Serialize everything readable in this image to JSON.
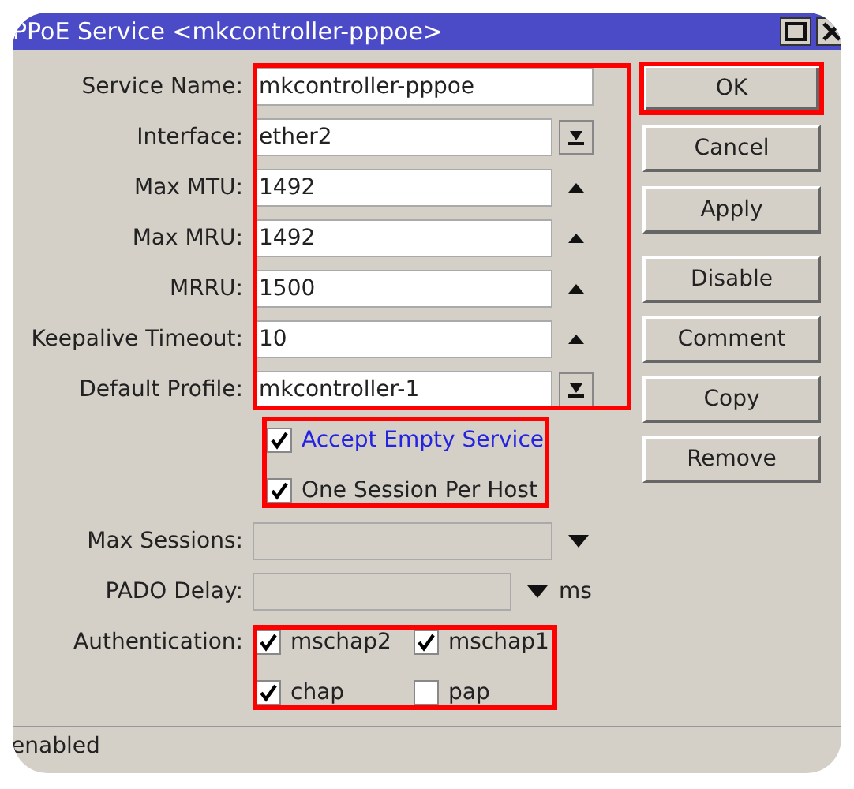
{
  "window": {
    "title": "PPoE Service <mkcontroller-pppoe>"
  },
  "fields_highlighted": true,
  "fields": [
    {
      "label": "Service Name:",
      "value": "mkcontroller-pppoe",
      "kind": "text"
    },
    {
      "label": "Interface:",
      "value": "ether2",
      "kind": "dropdown"
    },
    {
      "label": "Max MTU:",
      "value": "1492",
      "kind": "stepper"
    },
    {
      "label": "Max MRU:",
      "value": "1492",
      "kind": "stepper"
    },
    {
      "label": "MRRU:",
      "value": "1500",
      "kind": "stepper"
    },
    {
      "label": "Keepalive Timeout:",
      "value": "10",
      "kind": "stepper"
    },
    {
      "label": "Default Profile:",
      "value": "mkcontroller-1",
      "kind": "dropdown"
    }
  ],
  "options_highlighted": true,
  "options": [
    {
      "label": "Accept Empty Service",
      "checked": true,
      "kind": "link"
    },
    {
      "label": "One Session Per Host",
      "checked": true,
      "kind": "plain"
    }
  ],
  "extra_fields": [
    {
      "label": "Max Sessions:",
      "disabled": true
    },
    {
      "label": "PADO Delay:",
      "disabled": true,
      "unit": "ms"
    }
  ],
  "authentication": {
    "label": "Authentication:",
    "highlighted": true,
    "methods": [
      {
        "label": "mschap2",
        "checked": true
      },
      {
        "label": "mschap1",
        "checked": true
      },
      {
        "label": "chap",
        "checked": true
      },
      {
        "label": "pap",
        "checked": false
      }
    ]
  },
  "buttons": [
    {
      "label": "OK",
      "highlighted": true
    },
    {
      "label": "Cancel",
      "highlighted": false
    },
    {
      "label": "Apply",
      "highlighted": false
    },
    {
      "label": "Disable",
      "highlighted": false
    },
    {
      "label": "Comment",
      "highlighted": false
    },
    {
      "label": "Copy",
      "highlighted": false
    },
    {
      "label": "Remove",
      "highlighted": false
    }
  ],
  "status_bar": {
    "text": "enabled"
  }
}
